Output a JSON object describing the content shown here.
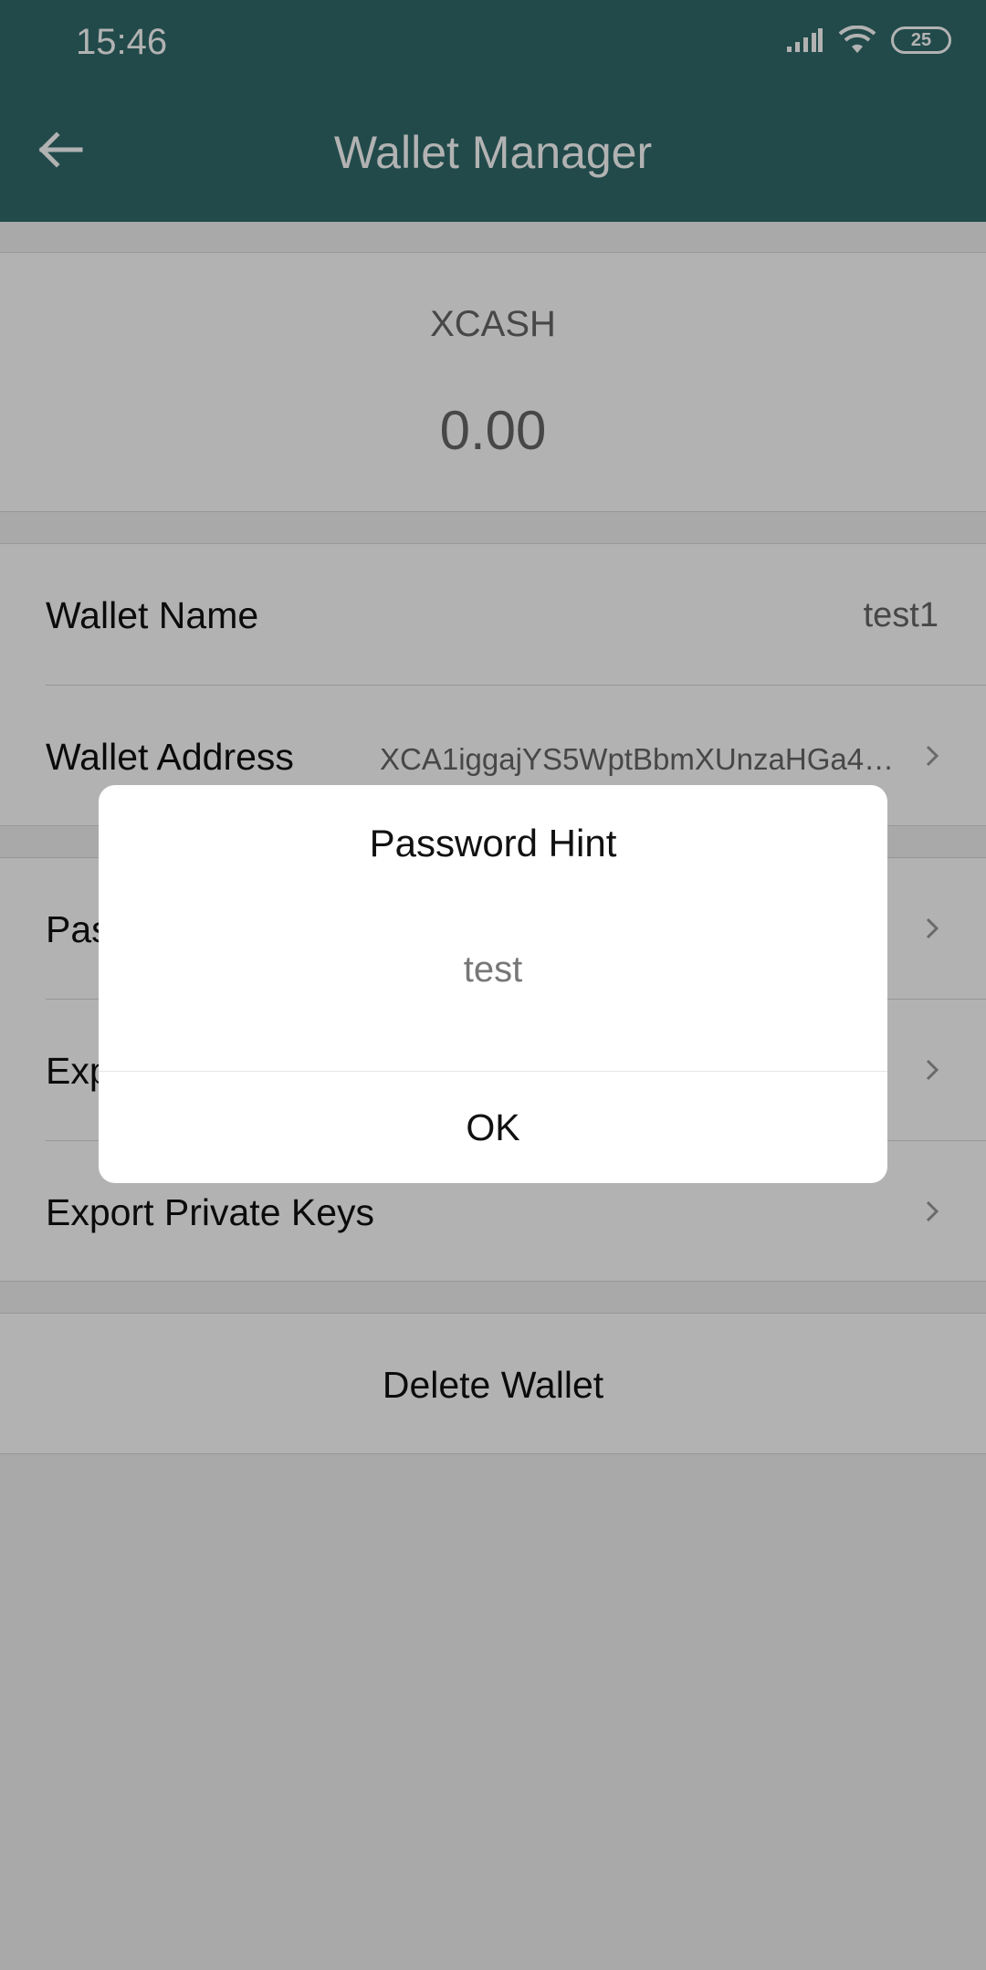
{
  "status_bar": {
    "time": "15:46",
    "battery": "25"
  },
  "app_bar": {
    "title": "Wallet Manager"
  },
  "balance": {
    "coin": "XCASH",
    "amount": "0.00"
  },
  "wallet_info": {
    "name_label": "Wallet Name",
    "name_value": "test1",
    "address_label": "Wallet Address",
    "address_value": "XCA1iggajYS5WptBbmXUnzaHGa4Q..."
  },
  "actions": {
    "items": [
      {
        "label": "Password Hint"
      },
      {
        "label": "Export Mnemonic"
      },
      {
        "label": "Export Private Keys"
      }
    ]
  },
  "delete": {
    "label": "Delete Wallet"
  },
  "dialog": {
    "title": "Password Hint",
    "message": "test",
    "ok_label": "OK"
  },
  "colors": {
    "primary": "#316a6b",
    "dim_overlay": "rgba(0,0,0,0.3)"
  }
}
